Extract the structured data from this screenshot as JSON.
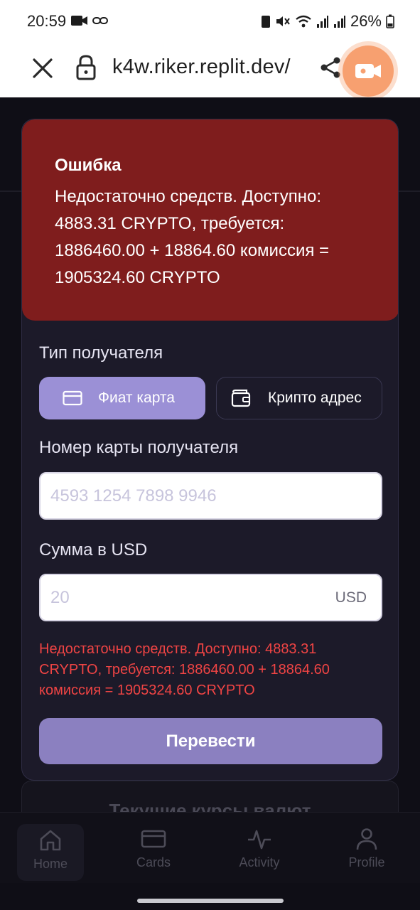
{
  "status_bar": {
    "time": "20:59",
    "battery": "26%"
  },
  "browser": {
    "url": "k4w.riker.replit.dev/"
  },
  "background": {
    "rates_title": "Текущие курсы валют"
  },
  "error_alert": {
    "title": "Ошибка",
    "message": "Недостаточно средств. Доступно: 4883.31 CRYPTO, требуется: 1886460.00 + 18864.60 комиссия = 1905324.60 CRYPTO"
  },
  "form": {
    "recipient_type_label": "Тип получателя",
    "fiat_option": "Фиат карта",
    "crypto_option": "Крипто адрес",
    "card_number_label": "Номер карты получателя",
    "card_number_placeholder": "4593 1254 7898 9946",
    "amount_label": "Сумма в USD",
    "amount_placeholder": "20",
    "amount_currency": "USD",
    "inline_error": "Недостаточно средств. Доступно: 4883.31 CRYPTO, требуется: 1886460.00 + 18864.60 комиссия = 1905324.60 CRYPTO",
    "submit_label": "Перевести"
  },
  "bottom_nav": {
    "items": [
      {
        "label": "Home",
        "icon": "home-icon"
      },
      {
        "label": "Cards",
        "icon": "card-icon"
      },
      {
        "label": "Activity",
        "icon": "activity-icon"
      },
      {
        "label": "Profile",
        "icon": "user-icon"
      }
    ]
  },
  "colors": {
    "error_bg": "#7f1d1d",
    "primary": "#9b90d6",
    "error_text": "#ef4444",
    "modal_bg": "#1c1a29"
  }
}
